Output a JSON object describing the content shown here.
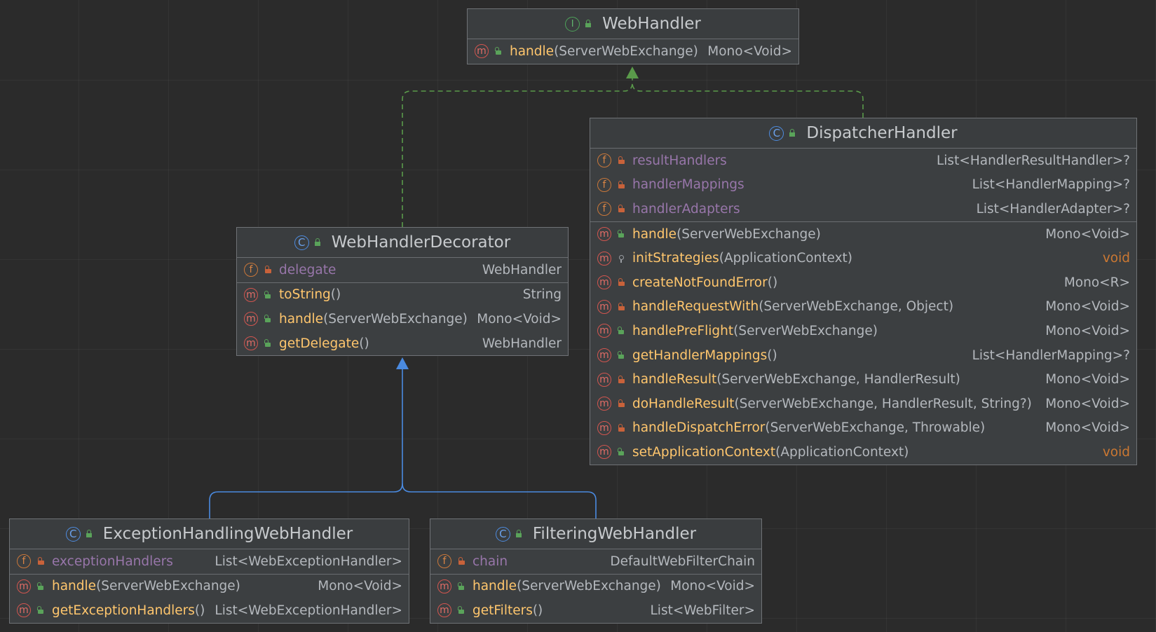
{
  "colors": {
    "background": "#2b2b2b",
    "node_fill": "#3c3f41",
    "realization_edge": "#5a9a4a",
    "inheritance_edge": "#4a8ae0",
    "method_name": "#ffc66d",
    "field_name": "#9876aa",
    "void_type": "#cc7832"
  },
  "nodes": {
    "webhandler": {
      "kind_icon": "I",
      "name": "WebHandler",
      "fields": [],
      "methods": [
        {
          "vis": "public",
          "name": "handle",
          "params": "(ServerWebExchange)",
          "type": "Mono<Void>"
        }
      ]
    },
    "dispatcher": {
      "kind_icon": "C",
      "name": "DispatcherHandler",
      "fields": [
        {
          "vis": "private",
          "name": "resultHandlers",
          "type": "List<HandlerResultHandler>?"
        },
        {
          "vis": "private",
          "name": "handlerMappings",
          "type": "List<HandlerMapping>?"
        },
        {
          "vis": "private",
          "name": "handlerAdapters",
          "type": "List<HandlerAdapter>?"
        }
      ],
      "methods": [
        {
          "vis": "public",
          "name": "handle",
          "params": "(ServerWebExchange)",
          "type": "Mono<Void>"
        },
        {
          "vis": "package",
          "name": "initStrategies",
          "params": "(ApplicationContext)",
          "type": "void"
        },
        {
          "vis": "private",
          "name": "createNotFoundError",
          "params": "()",
          "type": "Mono<R>"
        },
        {
          "vis": "private",
          "name": "handleRequestWith",
          "params": "(ServerWebExchange, Object)",
          "type": "Mono<Void>"
        },
        {
          "vis": "public",
          "name": "handlePreFlight",
          "params": "(ServerWebExchange)",
          "type": "Mono<Void>"
        },
        {
          "vis": "public",
          "name": "getHandlerMappings",
          "params": "()",
          "type": "List<HandlerMapping>?"
        },
        {
          "vis": "private",
          "name": "handleResult",
          "params": "(ServerWebExchange, HandlerResult)",
          "type": "Mono<Void>"
        },
        {
          "vis": "private",
          "name": "doHandleResult",
          "params": "(ServerWebExchange, HandlerResult, String?)",
          "type": "Mono<Void>"
        },
        {
          "vis": "private",
          "name": "handleDispatchError",
          "params": "(ServerWebExchange, Throwable)",
          "type": "Mono<Void>"
        },
        {
          "vis": "public",
          "name": "setApplicationContext",
          "params": "(ApplicationContext)",
          "type": "void"
        }
      ]
    },
    "decorator": {
      "kind_icon": "C",
      "name": "WebHandlerDecorator",
      "fields": [
        {
          "vis": "private",
          "name": "delegate",
          "type": "WebHandler"
        }
      ],
      "methods": [
        {
          "vis": "public",
          "name": "toString",
          "params": "()",
          "type": "String"
        },
        {
          "vis": "public",
          "name": "handle",
          "params": "(ServerWebExchange)",
          "type": "Mono<Void>"
        },
        {
          "vis": "public",
          "name": "getDelegate",
          "params": "()",
          "type": "WebHandler"
        }
      ]
    },
    "exception": {
      "kind_icon": "C",
      "name": "ExceptionHandlingWebHandler",
      "fields": [
        {
          "vis": "private",
          "name": "exceptionHandlers",
          "type": "List<WebExceptionHandler>"
        }
      ],
      "methods": [
        {
          "vis": "public",
          "name": "handle",
          "params": "(ServerWebExchange)",
          "type": "Mono<Void>"
        },
        {
          "vis": "public",
          "name": "getExceptionHandlers",
          "params": "()",
          "type": "List<WebExceptionHandler>"
        }
      ]
    },
    "filtering": {
      "kind_icon": "C",
      "name": "FilteringWebHandler",
      "fields": [
        {
          "vis": "private",
          "name": "chain",
          "type": "DefaultWebFilterChain"
        }
      ],
      "methods": [
        {
          "vis": "public",
          "name": "handle",
          "params": "(ServerWebExchange)",
          "type": "Mono<Void>"
        },
        {
          "vis": "public",
          "name": "getFilters",
          "params": "()",
          "type": "List<WebFilter>"
        }
      ]
    }
  },
  "edges": [
    {
      "from": "decorator",
      "to": "webhandler",
      "kind": "realization"
    },
    {
      "from": "dispatcher",
      "to": "webhandler",
      "kind": "realization"
    },
    {
      "from": "exception",
      "to": "decorator",
      "kind": "inheritance"
    },
    {
      "from": "filtering",
      "to": "decorator",
      "kind": "inheritance"
    }
  ]
}
